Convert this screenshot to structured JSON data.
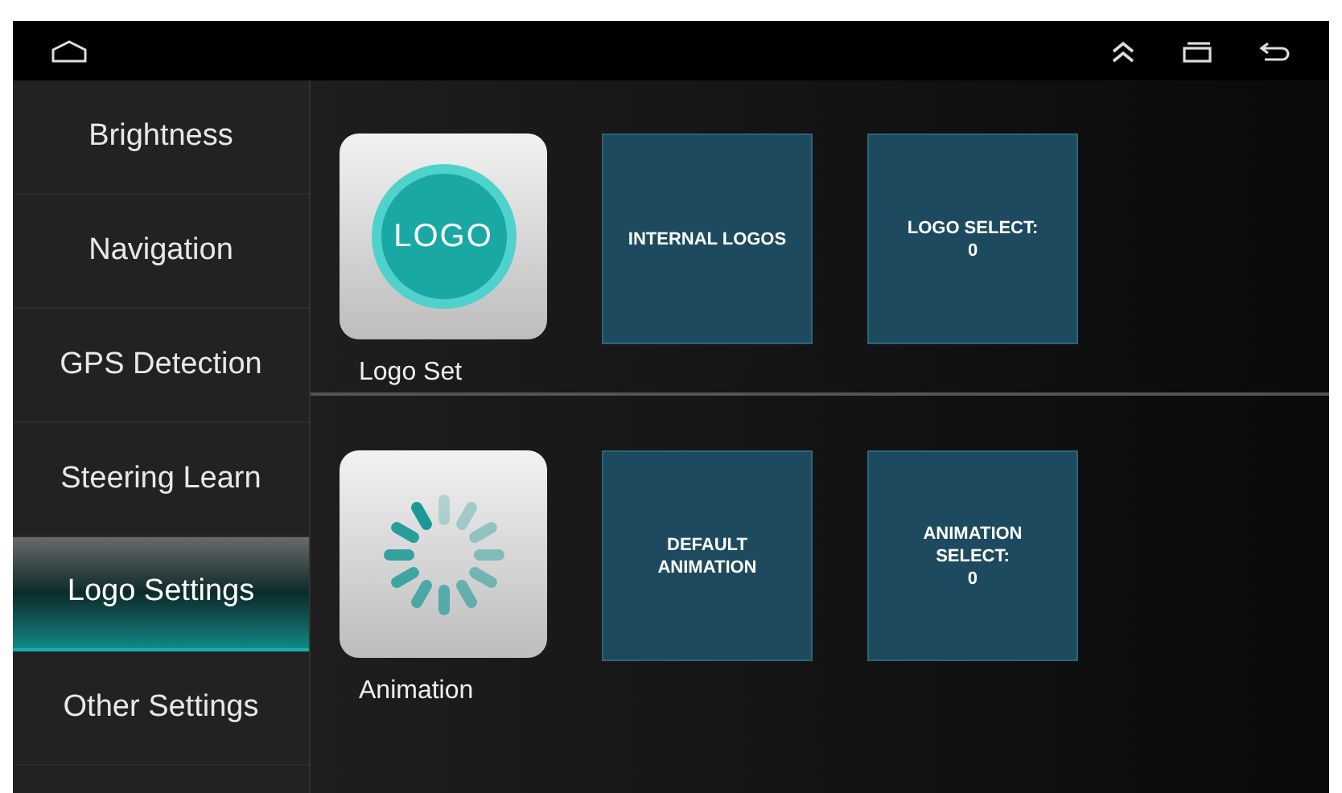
{
  "sidebar": {
    "items": [
      {
        "label": "Brightness",
        "selected": false
      },
      {
        "label": "Navigation",
        "selected": false
      },
      {
        "label": "GPS Detection",
        "selected": false
      },
      {
        "label": "Steering Learn",
        "selected": false
      },
      {
        "label": "Logo Settings",
        "selected": true
      },
      {
        "label": "Other Settings",
        "selected": false
      }
    ]
  },
  "sections": [
    {
      "kind": "logo",
      "label": "Logo Set",
      "logo_text": "LOGO",
      "tiles": [
        "INTERNAL LOGOS",
        "LOGO SELECT:\n0"
      ]
    },
    {
      "kind": "animation",
      "label": "Animation",
      "tiles": [
        "DEFAULT\nANIMATION",
        "ANIMATION\nSELECT:\n0"
      ]
    }
  ]
}
